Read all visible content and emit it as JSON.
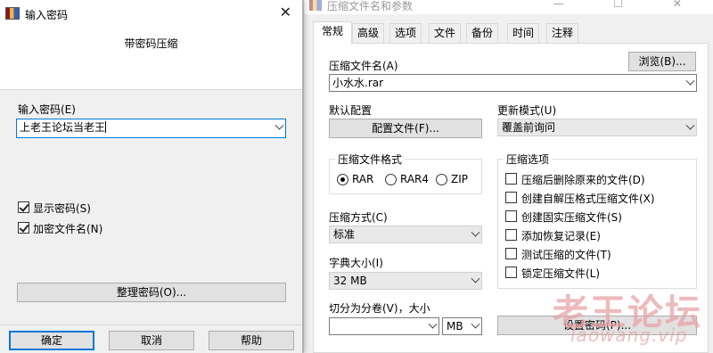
{
  "archive_window": {
    "title": "压缩文件名和参数",
    "title_buttons": "— ☐ ✕",
    "tabs": [
      "常规",
      "高级",
      "选项",
      "文件",
      "备份",
      "时间",
      "注释"
    ],
    "archive_name_label": "压缩文件名(A)",
    "browse_button": "浏览(B)...",
    "archive_name_value": "小水水.rar",
    "default_profile_label": "默认配置",
    "profiles_button": "配置文件(F)...",
    "update_mode_label": "更新模式(U)",
    "update_mode_value": "覆盖前询问",
    "format_group_title": "压缩文件格式",
    "format_options": [
      "RAR",
      "RAR4",
      "ZIP"
    ],
    "format_selected": "RAR",
    "options_group_title": "压缩选项",
    "archive_options": [
      {
        "label": "压缩后删除原来的文件(D)",
        "checked": false
      },
      {
        "label": "创建自解压格式压缩文件(X)",
        "checked": false
      },
      {
        "label": "创建固实压缩文件(S)",
        "checked": false
      },
      {
        "label": "添加恢复记录(E)",
        "checked": false
      },
      {
        "label": "测试压缩的文件(T)",
        "checked": false
      },
      {
        "label": "锁定压缩文件(L)",
        "checked": false
      }
    ],
    "method_label": "压缩方式(C)",
    "method_value": "标准",
    "dict_label": "字典大小(I)",
    "dict_value": "32 MB",
    "split_label": "切分为分卷(V)，大小",
    "split_value": "",
    "split_unit": "MB",
    "set_password_button": "设置密码(P)..."
  },
  "password_dialog": {
    "title": "输入密码",
    "close_glyph": "✕",
    "heading": "带密码压缩",
    "password_label": "输入密码(E)",
    "password_value": "上老王论坛当老王",
    "show_password": {
      "label": "显示密码(S)",
      "checked": true
    },
    "encrypt_names": {
      "label": "加密文件名(N)",
      "checked": true
    },
    "organize_button": "整理密码(O)...",
    "ok_button": "确定",
    "cancel_button": "取消",
    "help_button": "帮助"
  },
  "watermark": {
    "text": "老王论坛",
    "subtext": "laowang.vip",
    "color": "#e8a3a8"
  }
}
